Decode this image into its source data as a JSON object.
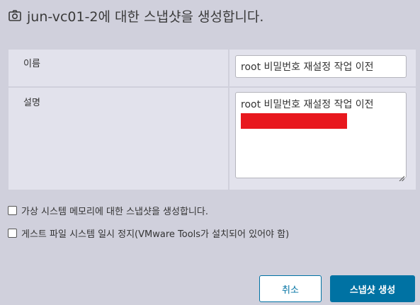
{
  "dialog": {
    "title": "jun-vc01-2에 대한 스냅샷을 생성합니다.",
    "title_icon": "camera-icon"
  },
  "form": {
    "name_label": "이름",
    "name_value": "root 비밀번호 재설정 작업 이전",
    "description_label": "설명",
    "description_value": "root 비밀번호 재설정 작업 이전",
    "redaction_color": "#e8181e"
  },
  "options": {
    "memory_snapshot_label": "가상 시스템 메모리에 대한 스냅샷을 생성합니다.",
    "memory_snapshot_checked": false,
    "quiesce_label": "게스트 파일 시스템 일시 정지(VMware Tools가 설치되어 있어야 함)",
    "quiesce_checked": false
  },
  "buttons": {
    "cancel_label": "취소",
    "create_label": "스냅샷 생성"
  },
  "colors": {
    "background": "#d0d0dc",
    "panel": "#e2e2ec",
    "accent": "#0072a3"
  }
}
